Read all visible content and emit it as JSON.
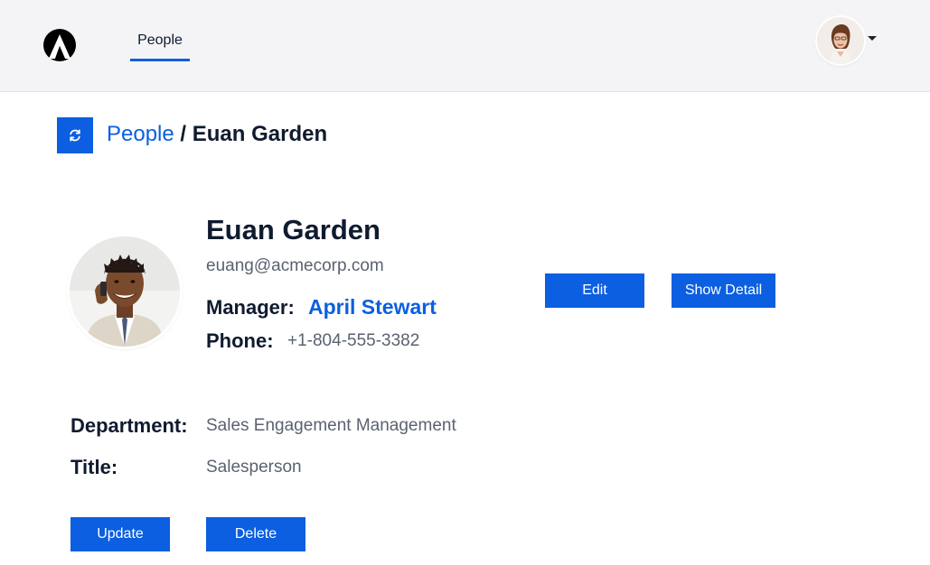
{
  "header": {
    "logo_icon": "delta-logo-icon",
    "nav": [
      {
        "label": "People",
        "active": true
      }
    ],
    "user_menu_icon": "caret-down-icon"
  },
  "breadcrumb": {
    "refresh_icon": "refresh-icon",
    "parent": "People",
    "separator": " / ",
    "current": "Euan Garden"
  },
  "profile": {
    "name": "Euan Garden",
    "email": "euang@acmecorp.com",
    "manager_label": "Manager:",
    "manager_name": "April Stewart",
    "phone_label": "Phone:",
    "phone": "+1-804-555-3382",
    "department_label": "Department:",
    "department": "Sales Engagement Management",
    "title_label": "Title:",
    "title": "Salesperson"
  },
  "actions": {
    "edit": "Edit",
    "show_detail": "Show Detail",
    "update": "Update",
    "delete": "Delete"
  },
  "colors": {
    "accent": "#0b5fe0",
    "header_bg": "#f4f4f6",
    "text_dark": "#0f1b2e",
    "text_muted": "#5a6270"
  }
}
